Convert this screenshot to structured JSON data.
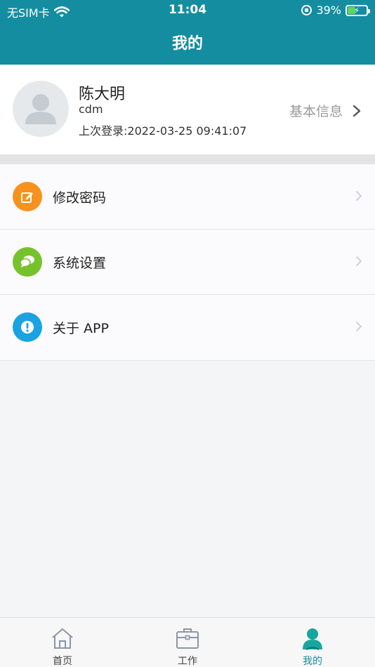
{
  "status_bar": {
    "carrier": "无SIM卡",
    "time": "11:04",
    "battery": "39%",
    "battery_level": 0.39
  },
  "header": {
    "title": "我的"
  },
  "profile": {
    "name": "陈大明",
    "username": "cdm",
    "last_login": "上次登录:2022-03-25 09:41:07",
    "link_label": "基本信息"
  },
  "menu": {
    "items": [
      {
        "label": "修改密码",
        "icon": "edit-icon",
        "color": "#f7921e"
      },
      {
        "label": "系统设置",
        "icon": "chat-icon",
        "color": "#76c22b"
      },
      {
        "label": "关于 APP",
        "icon": "info-icon",
        "color": "#1aa3e0"
      }
    ]
  },
  "tabbar": {
    "items": [
      {
        "label": "首页",
        "icon": "home-icon",
        "active": false
      },
      {
        "label": "工作",
        "icon": "briefcase-icon",
        "active": false
      },
      {
        "label": "我的",
        "icon": "user-icon",
        "active": true
      }
    ],
    "active_color": "#148da1"
  },
  "colors": {
    "primary": "#148da1",
    "background": "#f4f5f7"
  }
}
